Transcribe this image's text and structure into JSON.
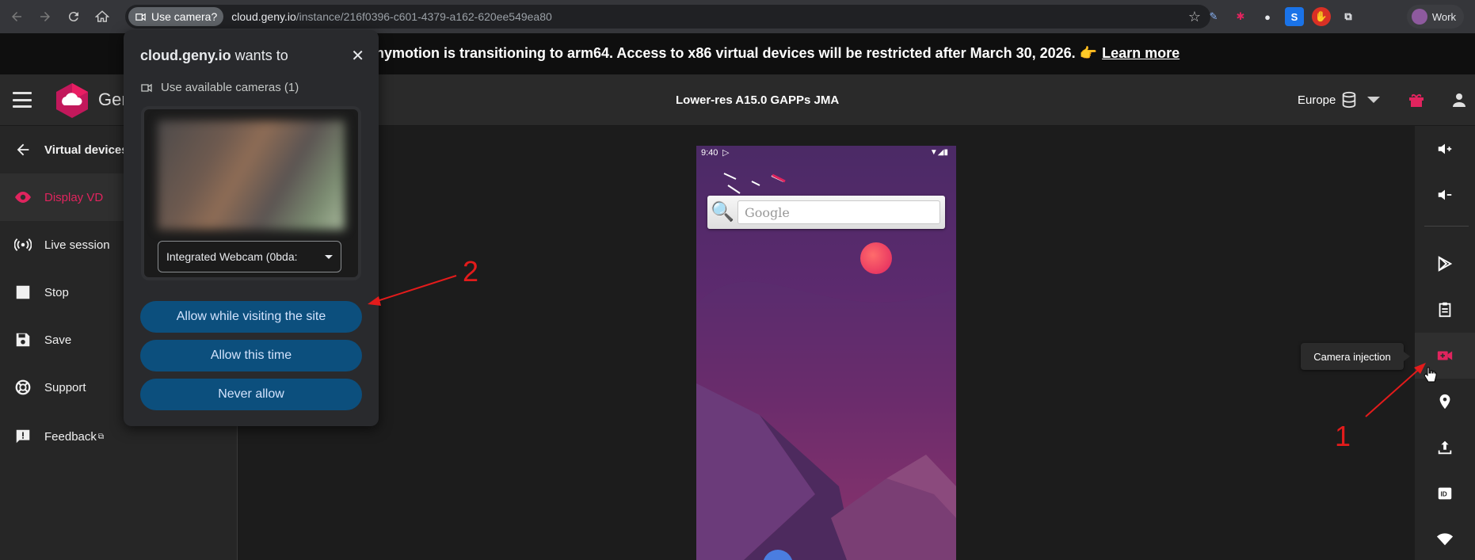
{
  "browser": {
    "permission_chip": "Use camera?",
    "url_host": "cloud.geny.io",
    "url_path": "/instance/216f0396-c601-4379-a162-620ee549ea80",
    "profile_name": "Work"
  },
  "banner": {
    "message": "nymotion is transitioning to arm64. Access to x86 virtual devices will be restricted after March 30, 2026. 👉",
    "link": "Learn more"
  },
  "header": {
    "logo_text": "Gen",
    "device_title": "Lower-res A15.0 GAPPs JMA",
    "region": "Europe"
  },
  "sidebar": {
    "items": [
      {
        "label": "Virtual devices",
        "icon": "arrow-left-icon"
      },
      {
        "label": "Display VD",
        "icon": "eye-icon"
      },
      {
        "label": "Live session",
        "icon": "broadcast-icon"
      },
      {
        "label": "Stop",
        "icon": "stop-icon"
      },
      {
        "label": "Save",
        "icon": "save-icon"
      },
      {
        "label": "Support",
        "icon": "lifebuoy-icon"
      },
      {
        "label": "Feedback",
        "icon": "feedback-icon"
      }
    ]
  },
  "phone": {
    "time": "9:40",
    "search_placeholder": "Google"
  },
  "toolbar": {
    "tooltip": "Camera injection"
  },
  "permission_popup": {
    "title_host": "cloud.geny.io",
    "title_rest": " wants to",
    "camera_row": "Use available cameras (1)",
    "camera_select": "Integrated Webcam (0bda:",
    "buttons": {
      "allow_visit": "Allow while visiting the site",
      "allow_once": "Allow this time",
      "never": "Never allow"
    }
  },
  "annotations": {
    "label_1": "1",
    "label_2": "2"
  },
  "colors": {
    "accent": "#e0245e",
    "button_bg": "#0c4f7d",
    "annotation": "#e31b1b"
  }
}
